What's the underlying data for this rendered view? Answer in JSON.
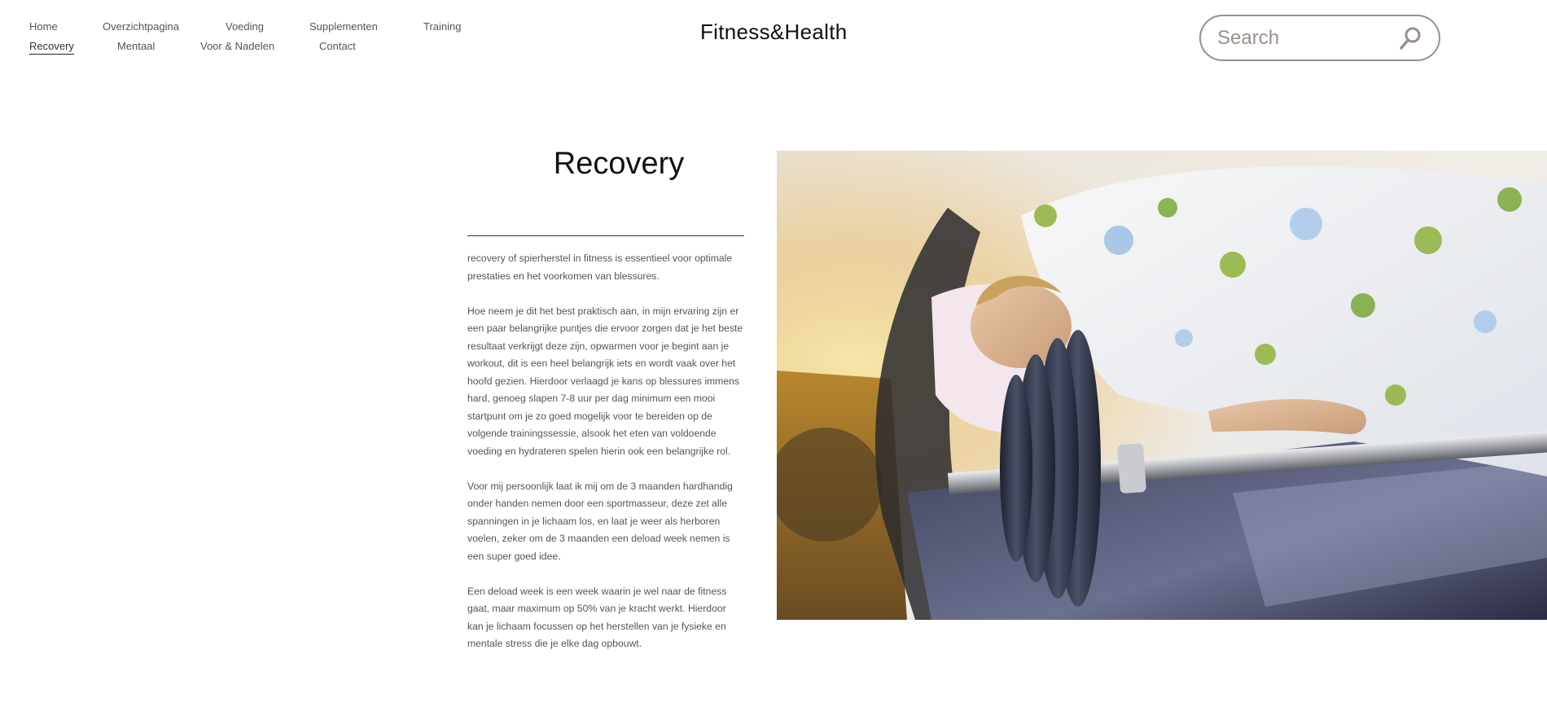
{
  "header": {
    "brand": "Fitness&Health",
    "nav_row1": [
      "Home",
      "Overzichtpagina",
      "Voeding",
      "Supplementen",
      "Training"
    ],
    "nav_row2": [
      "Recovery",
      "Mentaal",
      "Voor & Nadelen",
      "Contact"
    ],
    "active": "Recovery",
    "search": {
      "placeholder": "Search"
    }
  },
  "main": {
    "title": "Recovery",
    "paragraphs": [
      "recovery of spierherstel in fitness is essentieel voor optimale prestaties en het voorkomen van blessures.",
      "Hoe neem je dit het best praktisch aan, in mijn ervaring zijn er een paar belangrijke puntjes die ervoor zorgen dat je het beste resultaat verkrijgt deze zijn, opwarmen voor je begint aan je workout, dit is een heel belangrijk iets en wordt vaak over het hoofd gezien. Hierdoor verlaagd je kans op blessures immens hard, genoeg slapen 7-8 uur per dag minimum een mooi startpunt om je zo goed mogelijk voor te bereiden op de volgende trainingssessie, alsook het eten van voldoende voeding en hydrateren spelen hierin ook een belangrijke rol.",
      "Voor mij persoonlijk laat ik mij om de 3 maanden hardhandig onder handen nemen door een sportmasseur, deze zet alle spanningen in je lichaam los, en laat je weer als herboren voelen, zeker om de 3 maanden een deload week nemen is een super goed idee.",
      "Een deload week is een week waarin je wel naar de fitness gaat, maar maximum op 50% van je kracht werkt. Hierdoor kan je lichaam focussen op het herstellen van je fysieke en mentale stress die je elke dag opbouwt."
    ]
  },
  "colors": {
    "accent_border": "#9a8f8a",
    "text": "#555555",
    "heading": "#111111"
  }
}
